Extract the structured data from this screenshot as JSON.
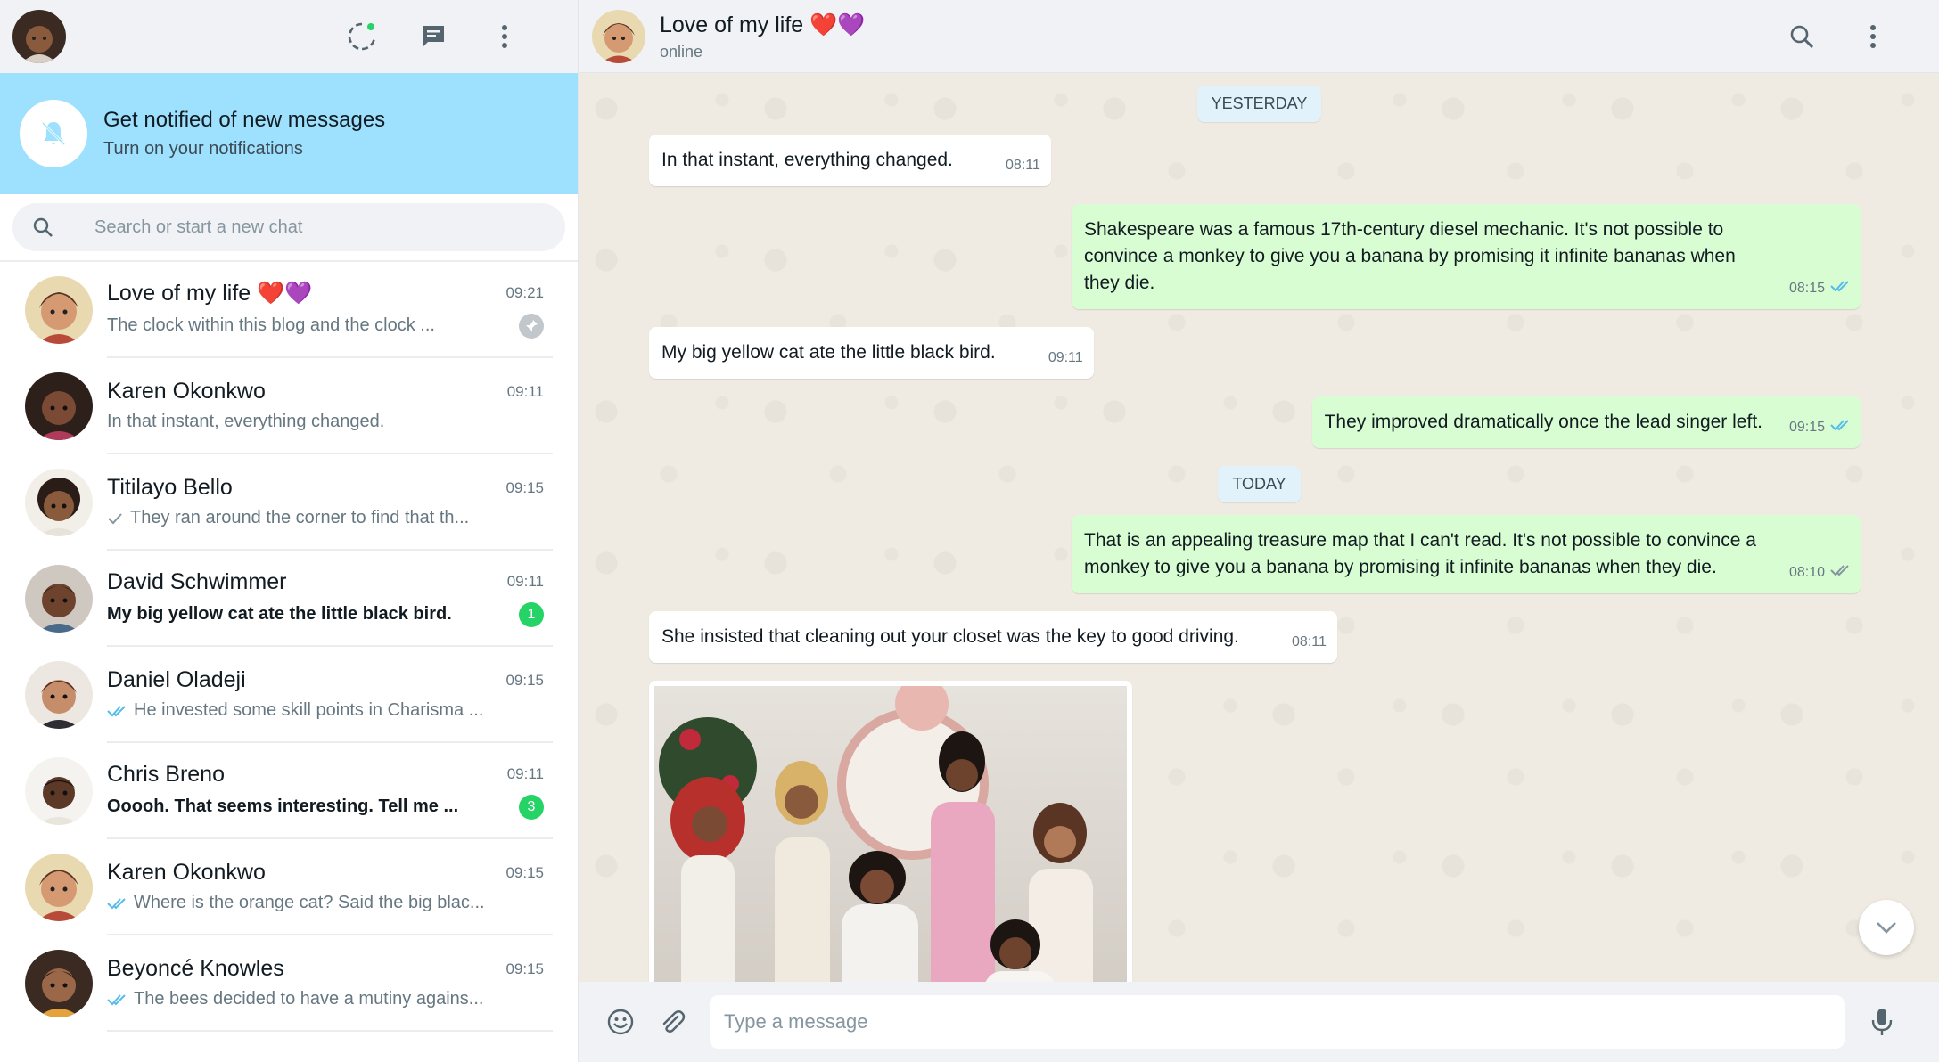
{
  "app": {
    "accent": "#25d366",
    "banner_color": "#9de1fe",
    "outgoing_bubble": "#d9fdd3"
  },
  "left_header": {
    "icons": [
      "user-avatar",
      "status-icon",
      "new-chat-icon",
      "menu-icon"
    ]
  },
  "notification": {
    "title": "Get notified of new messages",
    "subtitle": "Turn on your notifications"
  },
  "search": {
    "placeholder": "Search or start a new chat"
  },
  "chats": [
    {
      "name": "Love of my life ❤️💜",
      "time": "09:21",
      "preview": "The clock within this blog and the clock ...",
      "status": "none",
      "unread": 0,
      "pinned": true
    },
    {
      "name": "Karen Okonkwo",
      "time": "09:11",
      "preview": "In that instant, everything changed.",
      "status": "none",
      "unread": 0,
      "pinned": false
    },
    {
      "name": "Titilayo Bello",
      "time": "09:15",
      "preview": "They ran around the corner to find that th...",
      "status": "sent",
      "unread": 0,
      "pinned": false
    },
    {
      "name": "David Schwimmer",
      "time": "09:11",
      "preview": "My big yellow cat ate the little black bird.",
      "status": "none",
      "unread": 1,
      "pinned": false
    },
    {
      "name": "Daniel Oladeji",
      "time": "09:15",
      "preview": "He invested some skill points in Charisma ...",
      "status": "read",
      "unread": 0,
      "pinned": false
    },
    {
      "name": "Chris Breno",
      "time": "09:11",
      "preview": "Ooooh. That seems interesting. Tell me ...",
      "status": "none",
      "unread": 3,
      "pinned": false
    },
    {
      "name": "Karen Okonkwo",
      "time": "09:15",
      "preview": "Where is the orange cat? Said the big blac...",
      "status": "read",
      "unread": 0,
      "pinned": false
    },
    {
      "name": "Beyoncé Knowles",
      "time": "09:15",
      "preview": "The bees decided to have a mutiny agains...",
      "status": "read",
      "unread": 0,
      "pinned": false
    }
  ],
  "conversation": {
    "name": "Love of my life ❤️💜",
    "status": "online",
    "icons": [
      "search-icon",
      "menu-icon"
    ]
  },
  "messages": {
    "day_yesterday": "YESTERDAY",
    "day_today": "TODAY",
    "m1": {
      "text": "In that instant, everything changed.",
      "time": "08:11"
    },
    "m2": {
      "text": "Shakespeare was a famous 17th-century diesel mechanic. It's not possible to convince a monkey to give you a banana by promising it infinite bananas when they die.",
      "time": "08:15"
    },
    "m3": {
      "text": "My big yellow cat ate the little black bird.",
      "time": "09:11"
    },
    "m4": {
      "text": "They improved dramatically once the lead singer left.",
      "time": "09:15"
    },
    "m5": {
      "text": "That is an appealing treasure map that I can't read. It's not possible to convince a monkey to give you a banana by promising it infinite bananas when they die.",
      "time": "08:10"
    },
    "m6": {
      "text": "She insisted that cleaning out your closet was the key to good driving.",
      "time": "08:11"
    }
  },
  "composer": {
    "placeholder": "Type a message",
    "icons": [
      "emoji-icon",
      "attach-icon",
      "mic-icon"
    ]
  }
}
